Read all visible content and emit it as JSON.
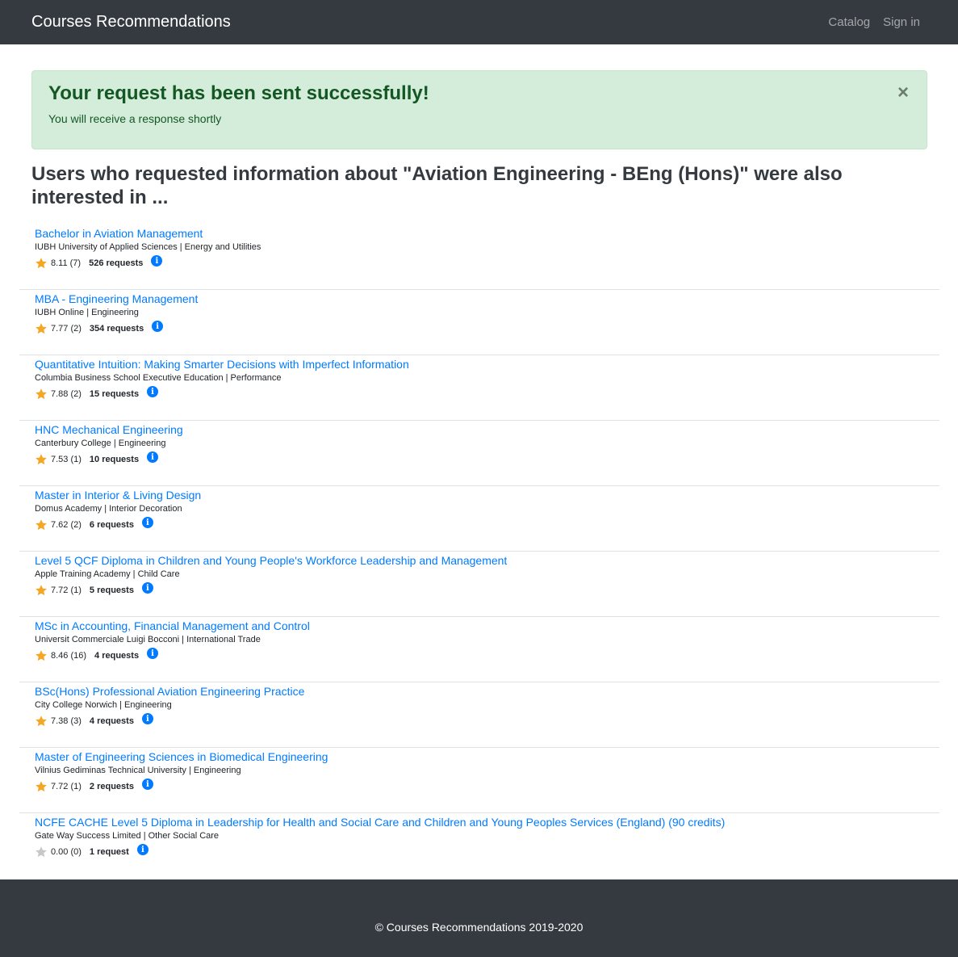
{
  "navbar": {
    "brand": "Courses Recommendations",
    "links": [
      "Catalog",
      "Sign in"
    ]
  },
  "alert": {
    "heading": "Your request has been sent successfully!",
    "text": "You will receive a response shortly",
    "close_icon": "×"
  },
  "section_title": "Users who requested information about \"Aviation Engineering - BEng (Hons)\" were also interested in ...",
  "colors": {
    "star_filled": "#f5a623",
    "star_empty": "#c8c8c8",
    "link": "#007bff",
    "nav_bg": "#343a40",
    "alert_bg": "#d4edda"
  },
  "courses": [
    {
      "title": "Bachelor in Aviation Management",
      "subtitle": "IUBH University of Applied Sciences | Energy and Utilities",
      "rating": "8.11 (7)",
      "requests": "526 requests",
      "star": "filled"
    },
    {
      "title": "MBA - Engineering Management",
      "subtitle": "IUBH Online | Engineering",
      "rating": "7.77 (2)",
      "requests": "354 requests",
      "star": "filled"
    },
    {
      "title": "Quantitative Intuition: Making Smarter Decisions with Imperfect Information",
      "subtitle": "Columbia Business School Executive Education | Performance",
      "rating": "7.88 (2)",
      "requests": "15 requests",
      "star": "filled"
    },
    {
      "title": "HNC Mechanical Engineering",
      "subtitle": "Canterbury College | Engineering",
      "rating": "7.53 (1)",
      "requests": "10 requests",
      "star": "filled"
    },
    {
      "title": "Master in Interior & Living Design",
      "subtitle": "Domus Academy | Interior Decoration",
      "rating": "7.62 (2)",
      "requests": "6 requests",
      "star": "filled"
    },
    {
      "title": "Level 5 QCF Diploma in Children and Young People's Workforce Leadership and Management",
      "subtitle": "Apple Training Academy | Child Care",
      "rating": "7.72 (1)",
      "requests": "5 requests",
      "star": "filled"
    },
    {
      "title": "MSc in Accounting, Financial Management and Control",
      "subtitle": "Universit Commerciale Luigi Bocconi | International Trade",
      "rating": "8.46 (16)",
      "requests": "4 requests",
      "star": "filled"
    },
    {
      "title": "BSc(Hons) Professional Aviation Engineering Practice",
      "subtitle": "City College Norwich | Engineering",
      "rating": "7.38 (3)",
      "requests": "4 requests",
      "star": "filled"
    },
    {
      "title": "Master of Engineering Sciences in Biomedical Engineering",
      "subtitle": "Vilnius Gediminas Technical University | Engineering",
      "rating": "7.72 (1)",
      "requests": "2 requests",
      "star": "filled"
    },
    {
      "title": "NCFE CACHE Level 5 Diploma in Leadership for Health and Social Care and Children and Young Peoples Services (England) (90 credits)",
      "subtitle": "Gate Way Success Limited | Other Social Care",
      "rating": "0.00 (0)",
      "requests": "1 request",
      "star": "empty"
    }
  ],
  "footer": {
    "text": "© Courses Recommendations 2019-2020"
  }
}
